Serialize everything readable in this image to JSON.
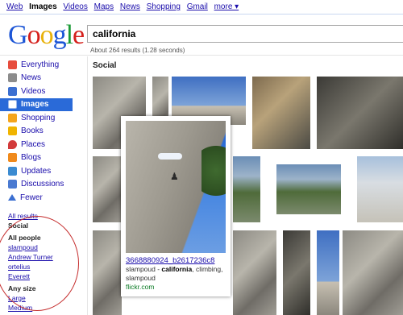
{
  "topnav": [
    "Web",
    "Images",
    "Videos",
    "Maps",
    "News",
    "Shopping",
    "Gmail",
    "more ▾"
  ],
  "logo": {
    "G": "G",
    "o1": "o",
    "o2": "o",
    "g": "g",
    "l": "l",
    "e": "e"
  },
  "search": {
    "value": "california"
  },
  "stats": "About 264 results (1.28 seconds)",
  "sidebar": {
    "items": [
      {
        "label": "Everything",
        "color": "#e74c3c"
      },
      {
        "label": "News",
        "color": "#8c8c8c"
      },
      {
        "label": "Videos",
        "color": "#3b6fd1"
      },
      {
        "label": "Images",
        "color": "#ffffff"
      },
      {
        "label": "Shopping",
        "color": "#f4a51c"
      },
      {
        "label": "Books",
        "color": "#f0b400"
      },
      {
        "label": "Places",
        "color": "#d23b3b"
      },
      {
        "label": "Blogs",
        "color": "#f08a1c"
      },
      {
        "label": "Updates",
        "color": "#3b8bd1"
      },
      {
        "label": "Discussions",
        "color": "#4a7ad1"
      },
      {
        "label": "Fewer",
        "color": "#3b6fd1"
      }
    ],
    "all_results": "All results",
    "social": "Social",
    "all_people": "All people",
    "people": [
      "slampoud",
      "Andrew Turner",
      "ortelius",
      "Everett"
    ],
    "any_size": "Any size",
    "sizes": [
      "Large",
      "Medium"
    ]
  },
  "main": {
    "section_title": "Social"
  },
  "popup": {
    "title": "3668880924_b2617236c8",
    "desc_user": "slampoud",
    "desc_sep": " - ",
    "desc_query": "california",
    "desc_rest": ", climbing,",
    "desc_line2": "slampoud",
    "url": "flickr.com"
  }
}
